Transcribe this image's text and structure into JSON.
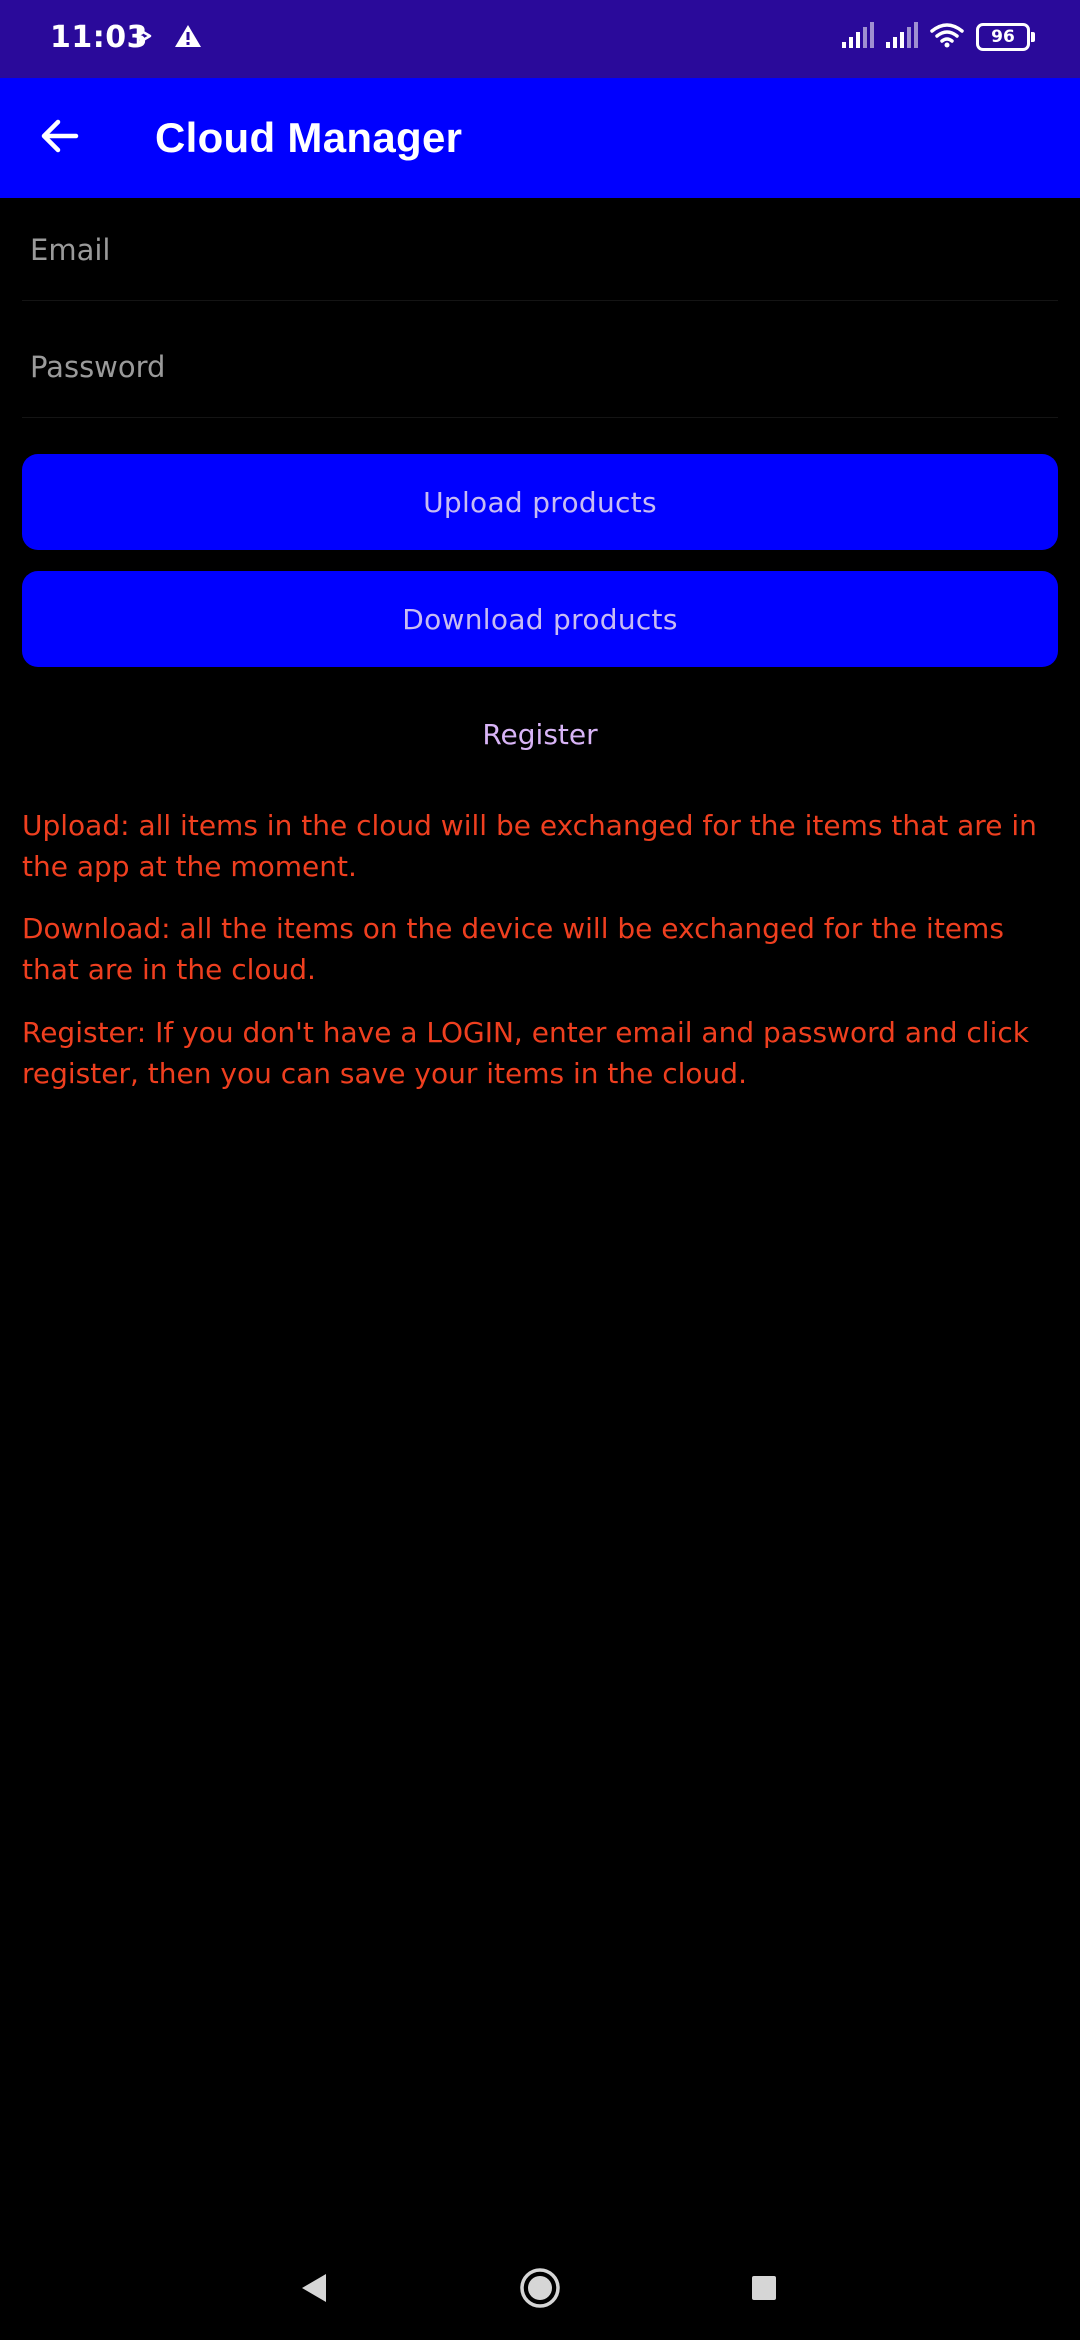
{
  "status_bar": {
    "time": "11:03",
    "battery": "96",
    "icons": [
      "play-icon",
      "warning-icon",
      "signal-icon",
      "signal-icon",
      "wifi-icon",
      "battery-icon"
    ]
  },
  "app_bar": {
    "title": "Cloud Manager",
    "back_icon": "arrow-left-icon"
  },
  "form": {
    "email_placeholder": "Email",
    "email_value": "",
    "password_placeholder": "Password",
    "password_value": ""
  },
  "buttons": {
    "upload_label": "Upload products",
    "download_label": "Download products",
    "register_label": "Register"
  },
  "info": {
    "upload": "Upload: all items in the cloud will be exchanged for the items that are in the app at the moment.",
    "download": "Download: all the items on the device will be exchanged for the items that are in the cloud.",
    "register": "Register: If you don't have a LOGIN, enter email and password and click register, then you can save your items in the cloud."
  },
  "nav_bar": {
    "icons": [
      "back-triangle-icon",
      "home-circle-icon",
      "recents-square-icon"
    ]
  },
  "colors": {
    "status_bar": "#2a0a9a",
    "app_bar": "#0000ff",
    "button": "#0000ff",
    "button_text": "#c8bcf3",
    "register_text": "#d8b4f6",
    "info_text": "#ef3f1f",
    "background": "#000000"
  }
}
